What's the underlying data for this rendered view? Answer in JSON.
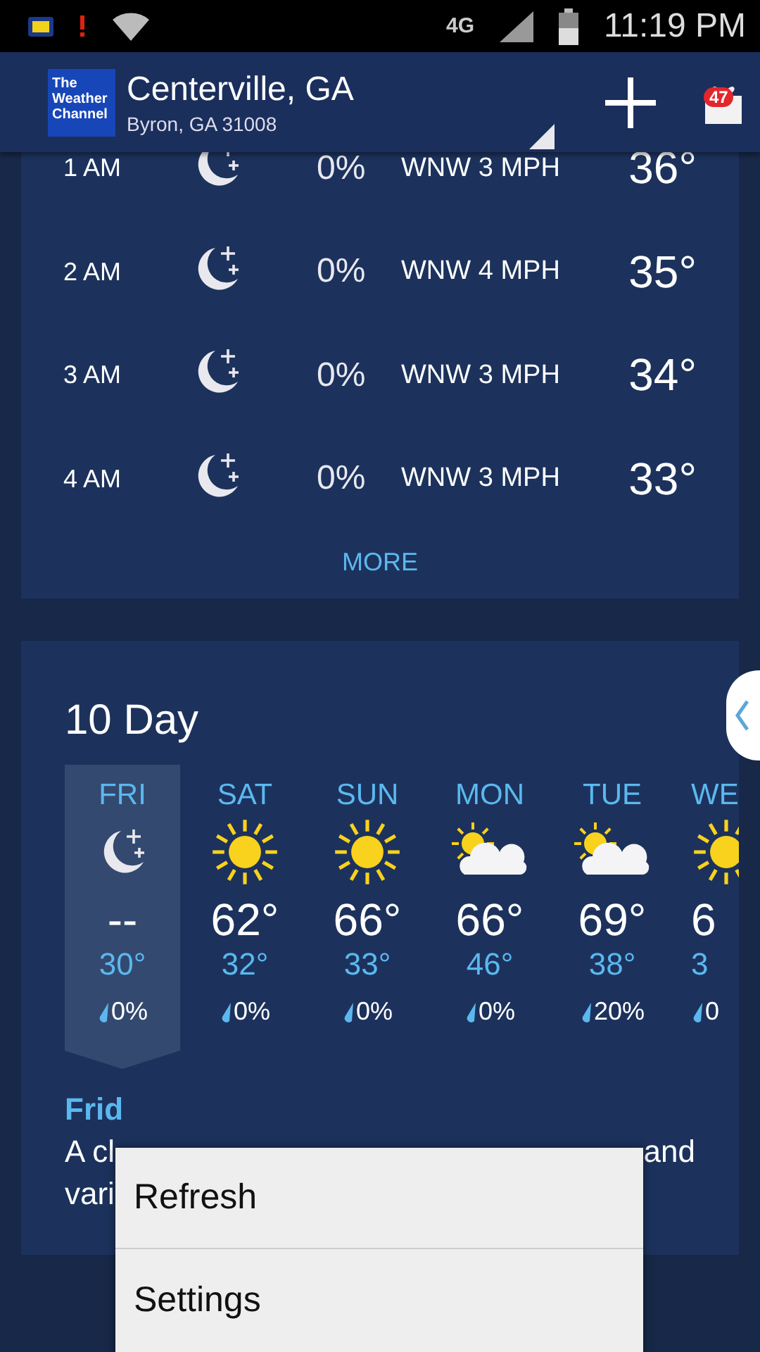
{
  "status_bar": {
    "network": "4G",
    "time": "11:19 PM"
  },
  "header": {
    "logo": "The Weather Channel",
    "title": "Centerville, GA",
    "subtitle": "Byron, GA 31008",
    "badge": "47"
  },
  "hourly": {
    "rows": [
      {
        "time": "1 AM",
        "kind": "moon",
        "precip": "0%",
        "wind": "WNW 3 MPH",
        "temp": "36°"
      },
      {
        "time": "2 AM",
        "kind": "moon",
        "precip": "0%",
        "wind": "WNW 4 MPH",
        "temp": "35°"
      },
      {
        "time": "3 AM",
        "kind": "moon",
        "precip": "0%",
        "wind": "WNW 3 MPH",
        "temp": "34°"
      },
      {
        "time": "4 AM",
        "kind": "moon",
        "precip": "0%",
        "wind": "WNW 3 MPH",
        "temp": "33°"
      }
    ],
    "more": "MORE"
  },
  "ten_day": {
    "title": "10 Day",
    "days": [
      {
        "day": "FRI",
        "kind": "moon",
        "high": "--",
        "low": "30°",
        "precip": "0%",
        "selected": true
      },
      {
        "day": "SAT",
        "kind": "sun",
        "high": "62°",
        "low": "32°",
        "precip": "0%",
        "selected": false
      },
      {
        "day": "SUN",
        "kind": "sun",
        "high": "66°",
        "low": "33°",
        "precip": "0%",
        "selected": false
      },
      {
        "day": "MON",
        "kind": "partly_cloudy",
        "high": "66°",
        "low": "46°",
        "precip": "0%",
        "selected": false
      },
      {
        "day": "TUE",
        "kind": "partly_cloudy",
        "high": "69°",
        "low": "38°",
        "precip": "20%",
        "selected": false
      },
      {
        "day": "WE",
        "kind": "sun",
        "high": "6",
        "low": "3",
        "precip": "0",
        "selected": false
      }
    ],
    "detail_heading": "Frid",
    "detail_lines": [
      [
        "A cl",
        "and"
      ],
      [
        "vari"
      ]
    ]
  },
  "menu": {
    "items": [
      "Refresh",
      "Settings"
    ]
  }
}
